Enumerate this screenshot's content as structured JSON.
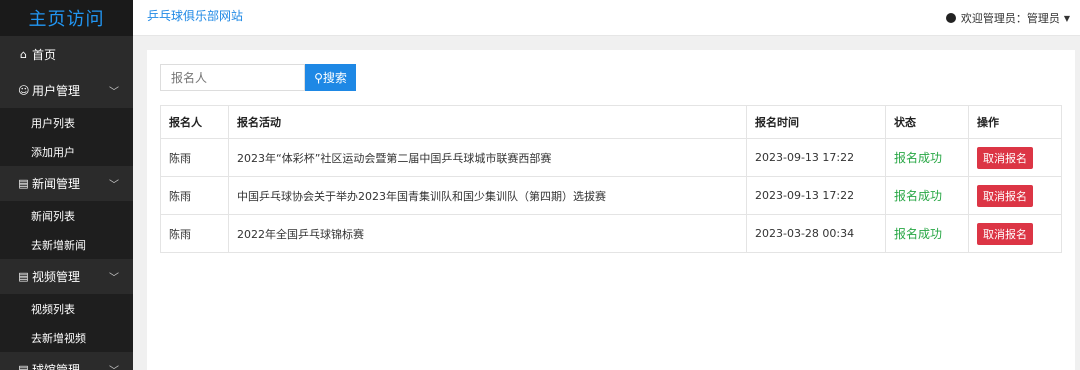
{
  "sidebar": {
    "logo": "主页访问",
    "home": "首页",
    "groups": [
      {
        "label": "用户管理",
        "items": [
          "用户列表",
          "添加用户"
        ]
      },
      {
        "label": "新闻管理",
        "items": [
          "新闻列表",
          "去新增新闻"
        ]
      },
      {
        "label": "视频管理",
        "items": [
          "视频列表",
          "去新增视频"
        ]
      },
      {
        "label": "球馆管理",
        "items": []
      }
    ]
  },
  "header": {
    "site_title": "乒乓球俱乐部网站",
    "welcome": "欢迎管理员：管理员"
  },
  "search": {
    "placeholder": "报名人",
    "button": "搜索"
  },
  "table": {
    "headers": [
      "报名人",
      "报名活动",
      "报名时间",
      "状态",
      "操作"
    ],
    "rows": [
      {
        "name": "陈雨",
        "activity": "2023年“体彩杯”社区运动会暨第二届中国乒乓球城市联赛西部赛",
        "time": "2023-09-13 17:22",
        "status": "报名成功",
        "action": "取消报名"
      },
      {
        "name": "陈雨",
        "activity": "中国乒乓球协会关于举办2023年国青集训队和国少集训队（第四期）选拔赛",
        "time": "2023-09-13 17:22",
        "status": "报名成功",
        "action": "取消报名"
      },
      {
        "name": "陈雨",
        "activity": "2022年全国乒乓球锦标赛",
        "time": "2023-03-28 00:34",
        "status": "报名成功",
        "action": "取消报名"
      }
    ]
  }
}
